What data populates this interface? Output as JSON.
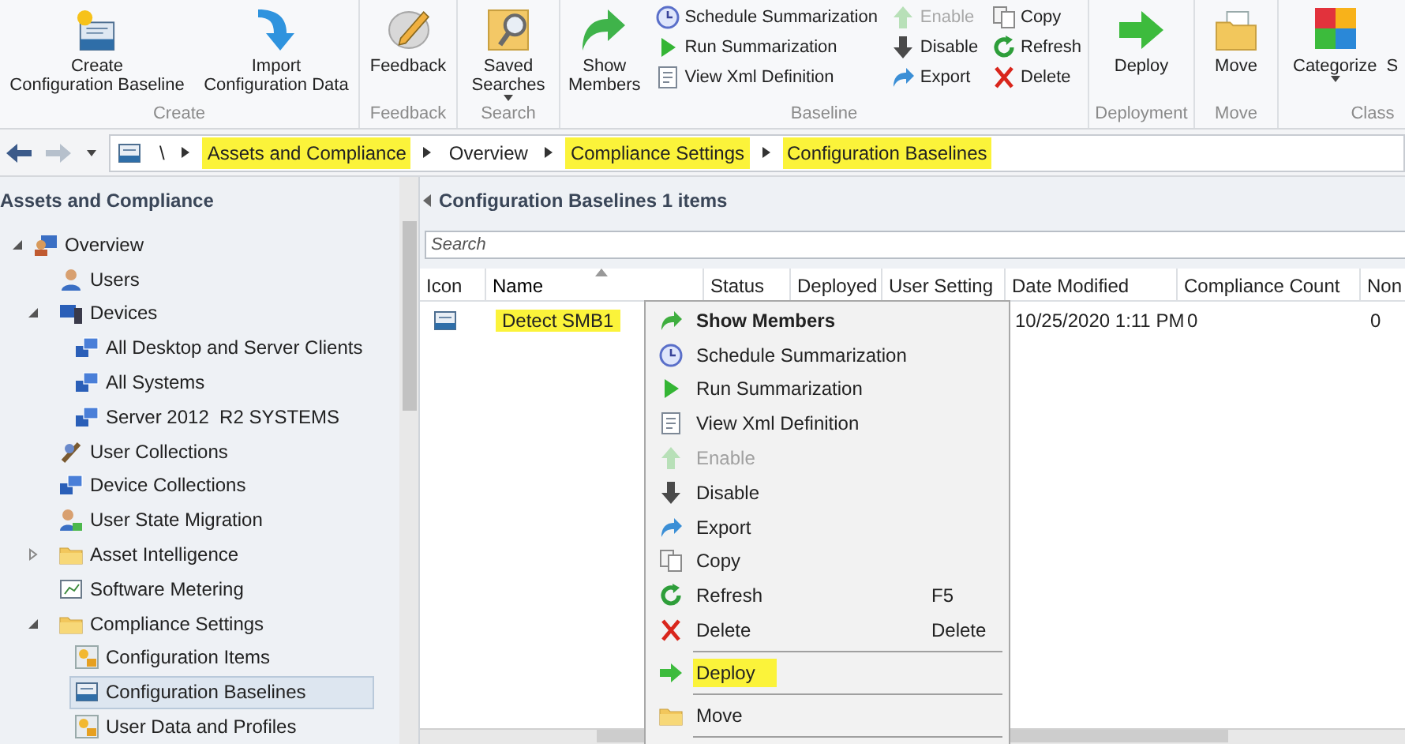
{
  "ribbon": {
    "groups": [
      {
        "label": "Create",
        "items": [
          {
            "kind": "large",
            "lines": [
              "Create",
              "Configuration Baseline"
            ],
            "dropdown": false
          },
          {
            "kind": "large",
            "lines": [
              "Import",
              "Configuration Data"
            ],
            "dropdown": false
          }
        ]
      },
      {
        "label": "Feedback",
        "items": [
          {
            "kind": "large",
            "lines": [
              "Feedback"
            ],
            "dropdown": false
          }
        ]
      },
      {
        "label": "Search",
        "items": [
          {
            "kind": "large",
            "lines": [
              "Saved",
              "Searches"
            ],
            "dropdown": true
          }
        ]
      },
      {
        "label": "Baseline",
        "items": [
          {
            "kind": "large",
            "lines": [
              "Show",
              "Members"
            ],
            "dropdown": false
          },
          {
            "kind": "column",
            "items": [
              {
                "label": "Schedule Summarization",
                "disabled": false
              },
              {
                "label": "Run Summarization",
                "disabled": false
              },
              {
                "label": "View Xml Definition",
                "disabled": false
              }
            ]
          },
          {
            "kind": "column",
            "items": [
              {
                "label": "Enable",
                "disabled": true
              },
              {
                "label": "Disable",
                "disabled": false
              },
              {
                "label": "Export",
                "disabled": false
              }
            ]
          },
          {
            "kind": "column",
            "items": [
              {
                "label": "Copy",
                "disabled": false
              },
              {
                "label": "Refresh",
                "disabled": false
              },
              {
                "label": "Delete",
                "disabled": false
              }
            ]
          }
        ]
      },
      {
        "label": "Deployment",
        "items": [
          {
            "kind": "large",
            "lines": [
              "Deploy"
            ],
            "dropdown": false
          }
        ]
      },
      {
        "label": "Move",
        "items": [
          {
            "kind": "large",
            "lines": [
              "Move"
            ],
            "dropdown": false
          }
        ]
      },
      {
        "label": "Class",
        "items": [
          {
            "kind": "large",
            "lines": [
              "Categorize"
            ],
            "dropdown": true
          },
          {
            "kind": "large",
            "lines": [
              "S"
            ],
            "dropdown": false
          }
        ]
      }
    ]
  },
  "address_bar": {
    "breadcrumbs": [
      {
        "label": "\\",
        "highlighted": false
      },
      {
        "label": "Assets and Compliance",
        "highlighted": true
      },
      {
        "label": "Overview",
        "highlighted": false
      },
      {
        "label": "Compliance Settings",
        "highlighted": true
      },
      {
        "label": "Configuration Baselines",
        "highlighted": true
      }
    ]
  },
  "nav": {
    "title": "Assets and Compliance",
    "tree": [
      {
        "label": "Overview",
        "expanded": true,
        "selected": false,
        "children": [
          {
            "label": "Users",
            "selected": false
          },
          {
            "label": "Devices",
            "expanded": true,
            "selected": false,
            "children": [
              {
                "label": "All Desktop and Server Clients",
                "selected": false
              },
              {
                "label": "All Systems",
                "selected": false
              },
              {
                "label": "Server 2012  R2 SYSTEMS",
                "selected": false
              }
            ]
          },
          {
            "label": "User Collections",
            "selected": false
          },
          {
            "label": "Device Collections",
            "selected": false
          },
          {
            "label": "User State Migration",
            "selected": false
          },
          {
            "label": "Asset Intelligence",
            "expanded": false,
            "selected": false
          },
          {
            "label": "Software Metering",
            "selected": false
          },
          {
            "label": "Compliance Settings",
            "expanded": true,
            "selected": false,
            "children": [
              {
                "label": "Configuration Items",
                "selected": false
              },
              {
                "label": "Configuration Baselines",
                "selected": true
              },
              {
                "label": "User Data and Profiles",
                "selected": false
              }
            ]
          }
        ]
      }
    ]
  },
  "list_pane": {
    "title": "Configuration Baselines 1 items",
    "search": {
      "placeholder": "Search"
    },
    "columns": [
      {
        "label": "Icon",
        "sorted": false
      },
      {
        "label": "Name",
        "sorted": true
      },
      {
        "label": "Status",
        "sorted": false
      },
      {
        "label": "Deployed",
        "sorted": false
      },
      {
        "label": "User Setting",
        "sorted": false
      },
      {
        "label": "Date Modified",
        "sorted": false
      },
      {
        "label": "Compliance Count",
        "sorted": false
      },
      {
        "label": "Non",
        "sorted": false
      }
    ],
    "rows": [
      {
        "name": "Detect SMB1",
        "name_highlighted": true,
        "date_modified": "10/25/2020 1:11 PM",
        "compliance_count": "0",
        "column_8": "0"
      }
    ]
  },
  "context_menu": {
    "items": [
      {
        "kind": "item",
        "label": "Show Members",
        "default": true,
        "disabled": false,
        "highlighted": false
      },
      {
        "kind": "item",
        "label": "Schedule Summarization",
        "default": false,
        "disabled": false,
        "highlighted": false
      },
      {
        "kind": "item",
        "label": "Run Summarization",
        "default": false,
        "disabled": false,
        "highlighted": false
      },
      {
        "kind": "item",
        "label": "View Xml Definition",
        "default": false,
        "disabled": false,
        "highlighted": false
      },
      {
        "kind": "item",
        "label": "Enable",
        "default": false,
        "disabled": true,
        "highlighted": false
      },
      {
        "kind": "item",
        "label": "Disable",
        "default": false,
        "disabled": false,
        "highlighted": false
      },
      {
        "kind": "item",
        "label": "Export",
        "default": false,
        "disabled": false,
        "highlighted": false
      },
      {
        "kind": "item",
        "label": "Copy",
        "default": false,
        "disabled": false,
        "highlighted": false
      },
      {
        "kind": "item",
        "label": "Refresh",
        "shortcut": "F5",
        "default": false,
        "disabled": false,
        "highlighted": false
      },
      {
        "kind": "item",
        "label": "Delete",
        "shortcut": "Delete",
        "default": false,
        "disabled": false,
        "highlighted": false
      },
      {
        "kind": "separator"
      },
      {
        "kind": "item",
        "label": "Deploy",
        "default": false,
        "disabled": false,
        "highlighted": true
      },
      {
        "kind": "separator"
      },
      {
        "kind": "item",
        "label": "Move",
        "default": false,
        "disabled": false,
        "highlighted": false
      },
      {
        "kind": "separator"
      }
    ]
  }
}
